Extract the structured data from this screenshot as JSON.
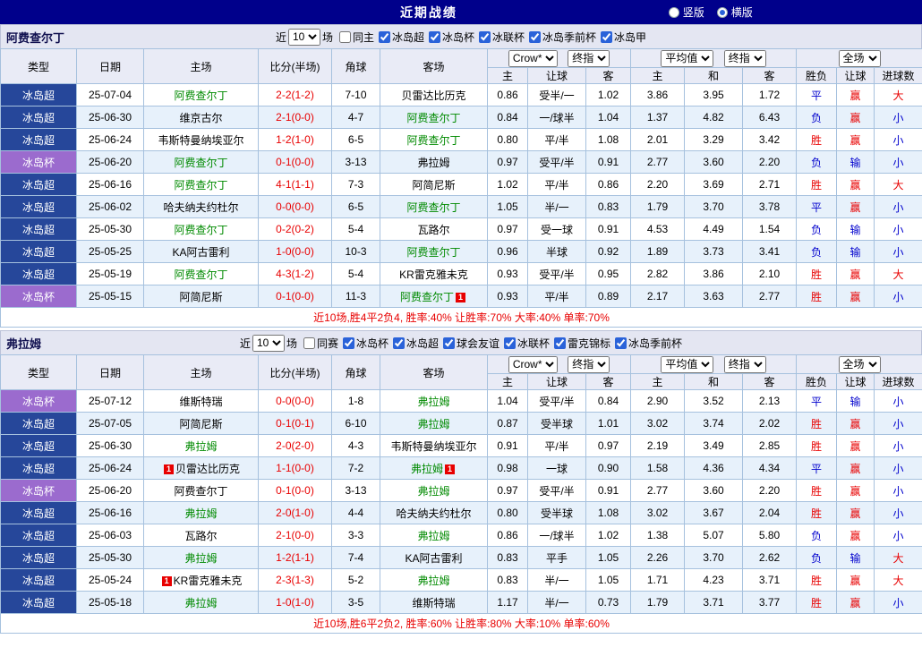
{
  "header": {
    "title": "近期战绩",
    "radios": [
      {
        "label": "竖版",
        "selected": false
      },
      {
        "label": "横版",
        "selected": true
      }
    ]
  },
  "labels": {
    "near": "近",
    "games": "场"
  },
  "table_header": {
    "main_cols": [
      "类型",
      "日期",
      "主场",
      "比分(半场)",
      "角球",
      "客场"
    ],
    "sub_cols": [
      "主",
      "让球",
      "客",
      "主",
      "和",
      "客",
      "胜负",
      "让球",
      "进球数"
    ],
    "odds1_book": "Crow*",
    "odds1_time": "终指",
    "odds2_book": "平均值",
    "odds2_time": "终指",
    "result_scope": "全场"
  },
  "sections": [
    {
      "team": "阿费查尔丁",
      "filter": {
        "count": "10",
        "checks": [
          {
            "label": "同主",
            "checked": false
          },
          {
            "label": "冰岛超",
            "checked": true
          },
          {
            "label": "冰岛杯",
            "checked": true
          },
          {
            "label": "冰联杯",
            "checked": true
          },
          {
            "label": "冰岛季前杯",
            "checked": true
          },
          {
            "label": "冰岛甲",
            "checked": true
          }
        ]
      },
      "rows": [
        {
          "league": "冰岛超",
          "cup": false,
          "date": "25-07-04",
          "home": "阿费查尔丁",
          "home_focus": true,
          "home_card": "",
          "score": "2-2(1-2)",
          "corners": "7-10",
          "away": "贝雷达比历克",
          "away_focus": false,
          "away_card": "",
          "crown": [
            "0.86",
            "受半/一",
            "1.02"
          ],
          "avg": [
            "3.86",
            "3.95",
            "1.72"
          ],
          "results": [
            "平",
            "赢",
            "大"
          ]
        },
        {
          "league": "冰岛超",
          "cup": false,
          "date": "25-06-30",
          "home": "维京古尔",
          "home_focus": false,
          "home_card": "",
          "score": "2-1(0-0)",
          "corners": "4-7",
          "away": "阿费查尔丁",
          "away_focus": true,
          "away_card": "",
          "crown": [
            "0.84",
            "一/球半",
            "1.04"
          ],
          "avg": [
            "1.37",
            "4.82",
            "6.43"
          ],
          "results": [
            "负",
            "赢",
            "小"
          ]
        },
        {
          "league": "冰岛超",
          "cup": false,
          "date": "25-06-24",
          "home": "韦斯特曼纳埃亚尔",
          "home_focus": false,
          "home_card": "",
          "score": "1-2(1-0)",
          "corners": "6-5",
          "away": "阿费查尔丁",
          "away_focus": true,
          "away_card": "",
          "crown": [
            "0.80",
            "平/半",
            "1.08"
          ],
          "avg": [
            "2.01",
            "3.29",
            "3.42"
          ],
          "results": [
            "胜",
            "赢",
            "小"
          ]
        },
        {
          "league": "冰岛杯",
          "cup": true,
          "date": "25-06-20",
          "home": "阿费查尔丁",
          "home_focus": true,
          "home_card": "",
          "score": "0-1(0-0)",
          "corners": "3-13",
          "away": "弗拉姆",
          "away_focus": false,
          "away_card": "",
          "crown": [
            "0.97",
            "受平/半",
            "0.91"
          ],
          "avg": [
            "2.77",
            "3.60",
            "2.20"
          ],
          "results": [
            "负",
            "输",
            "小"
          ]
        },
        {
          "league": "冰岛超",
          "cup": false,
          "date": "25-06-16",
          "home": "阿费查尔丁",
          "home_focus": true,
          "home_card": "",
          "score": "4-1(1-1)",
          "corners": "7-3",
          "away": "阿简尼斯",
          "away_focus": false,
          "away_card": "",
          "crown": [
            "1.02",
            "平/半",
            "0.86"
          ],
          "avg": [
            "2.20",
            "3.69",
            "2.71"
          ],
          "results": [
            "胜",
            "赢",
            "大"
          ]
        },
        {
          "league": "冰岛超",
          "cup": false,
          "date": "25-06-02",
          "home": "哈夫纳夫约杜尔",
          "home_focus": false,
          "home_card": "",
          "score": "0-0(0-0)",
          "corners": "6-5",
          "away": "阿费查尔丁",
          "away_focus": true,
          "away_card": "",
          "crown": [
            "1.05",
            "半/一",
            "0.83"
          ],
          "avg": [
            "1.79",
            "3.70",
            "3.78"
          ],
          "results": [
            "平",
            "赢",
            "小"
          ]
        },
        {
          "league": "冰岛超",
          "cup": false,
          "date": "25-05-30",
          "home": "阿费查尔丁",
          "home_focus": true,
          "home_card": "",
          "score": "0-2(0-2)",
          "corners": "5-4",
          "away": "瓦路尔",
          "away_focus": false,
          "away_card": "",
          "crown": [
            "0.97",
            "受一球",
            "0.91"
          ],
          "avg": [
            "4.53",
            "4.49",
            "1.54"
          ],
          "results": [
            "负",
            "输",
            "小"
          ]
        },
        {
          "league": "冰岛超",
          "cup": false,
          "date": "25-05-25",
          "home": "KA阿古雷利",
          "home_focus": false,
          "home_card": "",
          "score": "1-0(0-0)",
          "corners": "10-3",
          "away": "阿费查尔丁",
          "away_focus": true,
          "away_card": "",
          "crown": [
            "0.96",
            "半球",
            "0.92"
          ],
          "avg": [
            "1.89",
            "3.73",
            "3.41"
          ],
          "results": [
            "负",
            "输",
            "小"
          ]
        },
        {
          "league": "冰岛超",
          "cup": false,
          "date": "25-05-19",
          "home": "阿费查尔丁",
          "home_focus": true,
          "home_card": "",
          "score": "4-3(1-2)",
          "corners": "5-4",
          "away": "KR雷克雅未克",
          "away_focus": false,
          "away_card": "",
          "crown": [
            "0.93",
            "受平/半",
            "0.95"
          ],
          "avg": [
            "2.82",
            "3.86",
            "2.10"
          ],
          "results": [
            "胜",
            "赢",
            "大"
          ]
        },
        {
          "league": "冰岛杯",
          "cup": true,
          "date": "25-05-15",
          "home": "阿简尼斯",
          "home_focus": false,
          "home_card": "",
          "score": "0-1(0-0)",
          "corners": "11-3",
          "away": "阿费查尔丁",
          "away_focus": true,
          "away_card": "1",
          "crown": [
            "0.93",
            "平/半",
            "0.89"
          ],
          "avg": [
            "2.17",
            "3.63",
            "2.77"
          ],
          "results": [
            "胜",
            "赢",
            "小"
          ]
        }
      ],
      "summary": "近10场,胜4平2负4, 胜率:40% 让胜率:70% 大率:40% 单率:70%"
    },
    {
      "team": "弗拉姆",
      "filter": {
        "count": "10",
        "checks": [
          {
            "label": "同赛",
            "checked": false
          },
          {
            "label": "冰岛杯",
            "checked": true
          },
          {
            "label": "冰岛超",
            "checked": true
          },
          {
            "label": "球会友谊",
            "checked": true
          },
          {
            "label": "冰联杯",
            "checked": true
          },
          {
            "label": "雷克锦标",
            "checked": true
          },
          {
            "label": "冰岛季前杯",
            "checked": true
          }
        ]
      },
      "rows": [
        {
          "league": "冰岛杯",
          "cup": true,
          "date": "25-07-12",
          "home": "维斯特瑞",
          "home_focus": false,
          "home_card": "",
          "score": "0-0(0-0)",
          "corners": "1-8",
          "away": "弗拉姆",
          "away_focus": true,
          "away_card": "",
          "crown": [
            "1.04",
            "受平/半",
            "0.84"
          ],
          "avg": [
            "2.90",
            "3.52",
            "2.13"
          ],
          "results": [
            "平",
            "输",
            "小"
          ]
        },
        {
          "league": "冰岛超",
          "cup": false,
          "date": "25-07-05",
          "home": "阿简尼斯",
          "home_focus": false,
          "home_card": "",
          "score": "0-1(0-1)",
          "corners": "6-10",
          "away": "弗拉姆",
          "away_focus": true,
          "away_card": "",
          "crown": [
            "0.87",
            "受半球",
            "1.01"
          ],
          "avg": [
            "3.02",
            "3.74",
            "2.02"
          ],
          "results": [
            "胜",
            "赢",
            "小"
          ]
        },
        {
          "league": "冰岛超",
          "cup": false,
          "date": "25-06-30",
          "home": "弗拉姆",
          "home_focus": true,
          "home_card": "",
          "score": "2-0(2-0)",
          "corners": "4-3",
          "away": "韦斯特曼纳埃亚尔",
          "away_focus": false,
          "away_card": "",
          "crown": [
            "0.91",
            "平/半",
            "0.97"
          ],
          "avg": [
            "2.19",
            "3.49",
            "2.85"
          ],
          "results": [
            "胜",
            "赢",
            "小"
          ]
        },
        {
          "league": "冰岛超",
          "cup": false,
          "date": "25-06-24",
          "home": "贝雷达比历克",
          "home_focus": false,
          "home_card": "1",
          "score": "1-1(0-0)",
          "corners": "7-2",
          "away": "弗拉姆",
          "away_focus": true,
          "away_card": "1",
          "crown": [
            "0.98",
            "一球",
            "0.90"
          ],
          "avg": [
            "1.58",
            "4.36",
            "4.34"
          ],
          "results": [
            "平",
            "赢",
            "小"
          ]
        },
        {
          "league": "冰岛杯",
          "cup": true,
          "date": "25-06-20",
          "home": "阿费查尔丁",
          "home_focus": false,
          "home_card": "",
          "score": "0-1(0-0)",
          "corners": "3-13",
          "away": "弗拉姆",
          "away_focus": true,
          "away_card": "",
          "crown": [
            "0.97",
            "受平/半",
            "0.91"
          ],
          "avg": [
            "2.77",
            "3.60",
            "2.20"
          ],
          "results": [
            "胜",
            "赢",
            "小"
          ]
        },
        {
          "league": "冰岛超",
          "cup": false,
          "date": "25-06-16",
          "home": "弗拉姆",
          "home_focus": true,
          "home_card": "",
          "score": "2-0(1-0)",
          "corners": "4-4",
          "away": "哈夫纳夫约杜尔",
          "away_focus": false,
          "away_card": "",
          "crown": [
            "0.80",
            "受半球",
            "1.08"
          ],
          "avg": [
            "3.02",
            "3.67",
            "2.04"
          ],
          "results": [
            "胜",
            "赢",
            "小"
          ]
        },
        {
          "league": "冰岛超",
          "cup": false,
          "date": "25-06-03",
          "home": "瓦路尔",
          "home_focus": false,
          "home_card": "",
          "score": "2-1(0-0)",
          "corners": "3-3",
          "away": "弗拉姆",
          "away_focus": true,
          "away_card": "",
          "crown": [
            "0.86",
            "一/球半",
            "1.02"
          ],
          "avg": [
            "1.38",
            "5.07",
            "5.80"
          ],
          "results": [
            "负",
            "赢",
            "小"
          ]
        },
        {
          "league": "冰岛超",
          "cup": false,
          "date": "25-05-30",
          "home": "弗拉姆",
          "home_focus": true,
          "home_card": "",
          "score": "1-2(1-1)",
          "corners": "7-4",
          "away": "KA阿古雷利",
          "away_focus": false,
          "away_card": "",
          "crown": [
            "0.83",
            "平手",
            "1.05"
          ],
          "avg": [
            "2.26",
            "3.70",
            "2.62"
          ],
          "results": [
            "负",
            "输",
            "大"
          ]
        },
        {
          "league": "冰岛超",
          "cup": false,
          "date": "25-05-24",
          "home": "KR雷克雅未克",
          "home_focus": false,
          "home_card": "1",
          "score": "2-3(1-3)",
          "corners": "5-2",
          "away": "弗拉姆",
          "away_focus": true,
          "away_card": "",
          "crown": [
            "0.83",
            "半/一",
            "1.05"
          ],
          "avg": [
            "1.71",
            "4.23",
            "3.71"
          ],
          "results": [
            "胜",
            "赢",
            "大"
          ]
        },
        {
          "league": "冰岛超",
          "cup": false,
          "date": "25-05-18",
          "home": "弗拉姆",
          "home_focus": true,
          "home_card": "",
          "score": "1-0(1-0)",
          "corners": "3-5",
          "away": "维斯特瑞",
          "away_focus": false,
          "away_card": "",
          "crown": [
            "1.17",
            "半/一",
            "0.73"
          ],
          "avg": [
            "1.79",
            "3.71",
            "3.77"
          ],
          "results": [
            "胜",
            "赢",
            "小"
          ]
        }
      ],
      "summary": "近10场,胜6平2负2, 胜率:60% 让胜率:80% 大率:10% 单率:60%"
    }
  ]
}
